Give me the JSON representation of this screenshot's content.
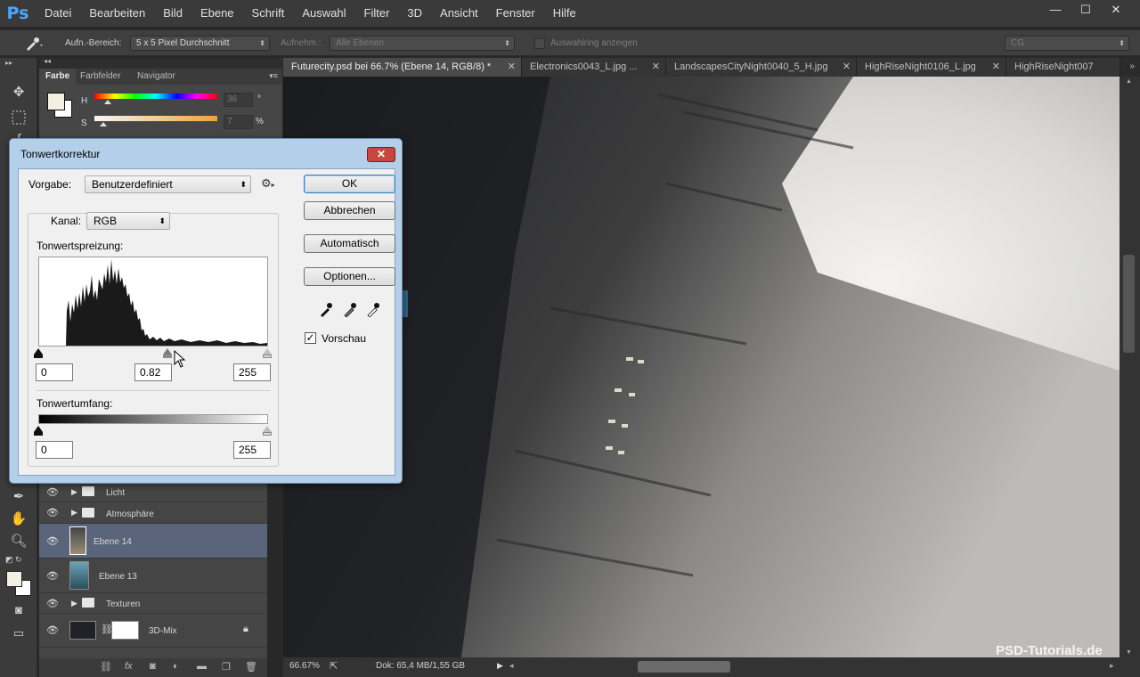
{
  "app": {
    "logo": "Ps"
  },
  "menu": [
    "Datei",
    "Bearbeiten",
    "Bild",
    "Ebene",
    "Schrift",
    "Auswahl",
    "Filter",
    "3D",
    "Ansicht",
    "Fenster",
    "Hilfe"
  ],
  "window_controls": {
    "minimize": "—",
    "maximize": "☐",
    "close": "✕"
  },
  "options_bar": {
    "sample_size_label": "Aufn.-Bereich:",
    "sample_size_value": "5 x 5 Pixel Durchschnitt",
    "sample_label": "Aufnehm.:",
    "sample_value": "Alle Ebenen",
    "show_ring_label": "Auswahlring anzeigen",
    "workspace_value": "CG"
  },
  "color_panel": {
    "tabs": [
      "Farbe",
      "Farbfelder",
      "Navigator"
    ],
    "h_label": "H",
    "h_value": "36",
    "h_unit": "°",
    "s_label": "S",
    "s_value": "7",
    "s_unit": "%"
  },
  "doc_tabs": [
    {
      "label": "Futurecity.psd bei 66.7% (Ebene 14, RGB/8) *",
      "active": true
    },
    {
      "label": "Electronics0043_L.jpg ...",
      "active": false
    },
    {
      "label": "LandscapesCityNight0040_5_H.jpg",
      "active": false
    },
    {
      "label": "HighRiseNight0106_L.jpg",
      "active": false
    },
    {
      "label": "HighRiseNight007",
      "active": false
    }
  ],
  "levels_dialog": {
    "title": "Tonwertkorrektur",
    "close": "✕",
    "preset_label": "Vorgabe:",
    "preset_value": "Benutzerdefiniert",
    "channel_label": "Kanal:",
    "channel_value": "RGB",
    "input_levels_label": "Tonwertspreizung:",
    "input_black": "0",
    "input_gamma": "0.82",
    "input_white": "255",
    "output_levels_label": "Tonwertumfang:",
    "output_black": "0",
    "output_white": "255",
    "buttons": {
      "ok": "OK",
      "cancel": "Abbrechen",
      "auto": "Automatisch",
      "options": "Optionen..."
    },
    "preview_label": "Vorschau",
    "preview_checked": true
  },
  "layers": [
    {
      "name": "Licht",
      "type": "group",
      "selected": false
    },
    {
      "name": "Atmosphäre",
      "type": "group",
      "selected": false
    },
    {
      "name": "Ebene 14",
      "type": "layer",
      "selected": true
    },
    {
      "name": "Ebene 13",
      "type": "layer",
      "selected": false
    },
    {
      "name": "Texturen",
      "type": "group",
      "selected": false
    },
    {
      "name": "3D-Mix",
      "type": "adjustment",
      "selected": false
    }
  ],
  "status": {
    "zoom": "66.67%",
    "doc_size": "Dok: 65,4 MB/1,55 GB"
  },
  "watermark": "PSD-Tutorials.de"
}
